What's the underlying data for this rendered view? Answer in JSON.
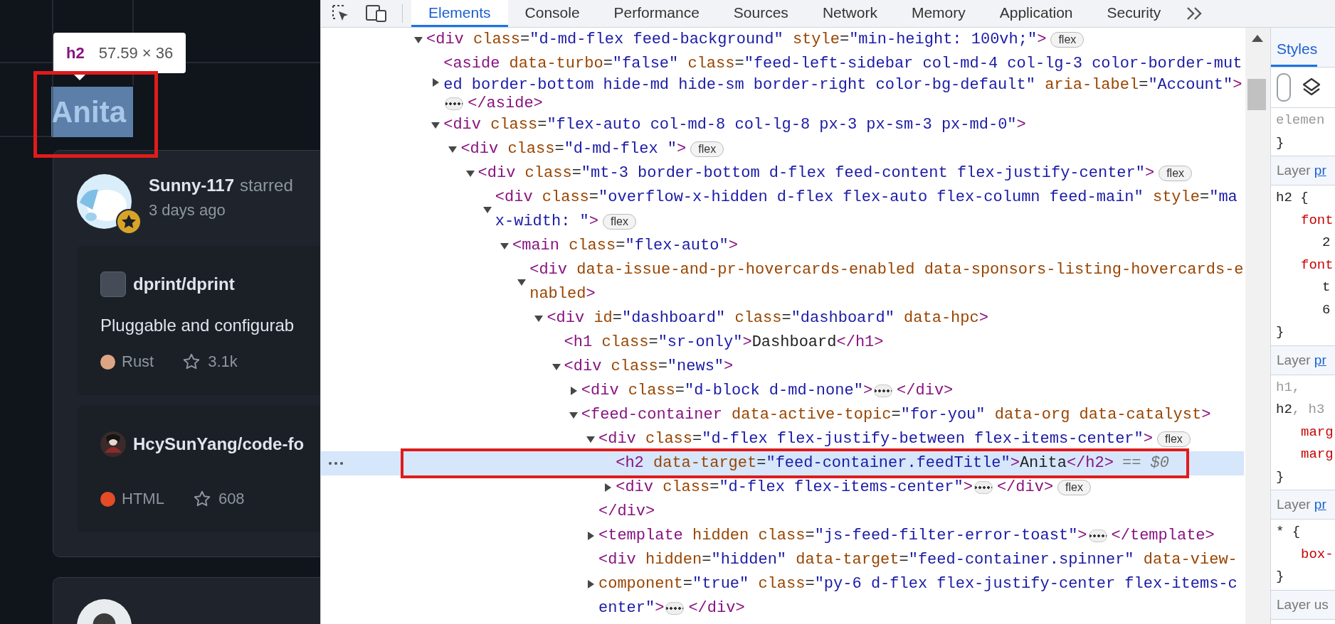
{
  "page": {
    "tooltip": {
      "tag": "h2",
      "size": "57.59 × 36"
    },
    "heading": "Anita",
    "feed": [
      {
        "kind": "star_event",
        "actor": "Sunny-117",
        "action": "starred",
        "time": "3 days ago",
        "repos": [
          {
            "kind": "icon",
            "name": "dprint/dprint",
            "description": "Pluggable and configurab",
            "language": "Rust",
            "color": "#dea584",
            "star_count": "3.1k"
          },
          {
            "kind": "avatar",
            "name": "HcySunYang/code-fo",
            "language": "HTML",
            "color": "#e34c26",
            "star_count": "608"
          }
        ]
      },
      {
        "kind": "partial"
      }
    ]
  },
  "devtools": {
    "tabs": [
      {
        "label": "Elements",
        "selected": true
      },
      {
        "label": "Console",
        "selected": false
      },
      {
        "label": "Performance",
        "selected": false
      },
      {
        "label": "Sources",
        "selected": false
      },
      {
        "label": "Network",
        "selected": false
      },
      {
        "label": "Memory",
        "selected": false
      },
      {
        "label": "Application",
        "selected": false
      },
      {
        "label": "Security",
        "selected": false
      }
    ],
    "tree": {
      "nodes": [
        {
          "markup": "<div class=\"d-md-flex feed-background\" style=\"min-height: 100vh;\">",
          "expanded": true,
          "selected": false,
          "badge": "flex",
          "children": [
            {
              "markup": "<aside data-turbo=\"false\" class=\"feed-left-sidebar col-md-4 col-lg-3 color-border-muted border-bottom hide-md hide-sm border-right color-bg-default\" aria-label=\"Account\">",
              "expanded": false,
              "selected": false,
              "ellipsis": true,
              "end": "</aside>"
            },
            {
              "markup": "<div class=\"flex-auto col-md-8 col-lg-8 px-3 px-sm-3 px-md-0\">",
              "expanded": true,
              "selected": false,
              "children": [
                {
                  "markup": "<div class=\"d-md-flex \">",
                  "expanded": true,
                  "selected": false,
                  "badge": "flex",
                  "children": [
                    {
                      "markup": "<div class=\"mt-3 border-bottom d-flex feed-content flex-justify-center\">",
                      "expanded": true,
                      "selected": false,
                      "badge": "flex",
                      "children": [
                        {
                          "markup": "<div class=\"overflow-x-hidden d-flex flex-auto flex-column feed-main\" style=\"max-width: \">",
                          "expanded": true,
                          "selected": false,
                          "badge": "flex",
                          "children": [
                            {
                              "markup": "<main class=\"flex-auto\">",
                              "expanded": true,
                              "selected": false,
                              "children": [
                                {
                                  "markup": "<div data-issue-and-pr-hovercards-enabled data-sponsors-listing-hovercards-enabled>",
                                  "expanded": true,
                                  "selected": false,
                                  "children": [
                                    {
                                      "markup": "<div id=\"dashboard\" class=\"dashboard\" data-hpc>",
                                      "expanded": true,
                                      "selected": false,
                                      "children": [
                                        {
                                          "markup": "<h1 class=\"sr-only\">Dashboard</h1>",
                                          "selected": false
                                        },
                                        {
                                          "markup": "<div class=\"news\">",
                                          "expanded": true,
                                          "selected": false,
                                          "children": [
                                            {
                                              "markup": "<div class=\"d-block d-md-none\">",
                                              "expanded": false,
                                              "selected": false,
                                              "ellipsis": true,
                                              "end": "</div>"
                                            },
                                            {
                                              "markup": "<feed-container data-active-topic=\"for-you\" data-org data-catalyst>",
                                              "expanded": true,
                                              "selected": false,
                                              "children": [
                                                {
                                                  "markup": "<div class=\"d-flex flex-justify-between flex-items-center\">",
                                                  "expanded": true,
                                                  "selected": false,
                                                  "badge": "flex",
                                                  "closing": "</div>",
                                                  "children": [
                                                    {
                                                      "markup": "<h2 data-target=\"feed-container.feedTitle\">Anita</h2>",
                                                      "selected": true,
                                                      "annotation": "== $0"
                                                    },
                                                    {
                                                      "markup": "<div class=\"d-flex flex-items-center\">",
                                                      "expanded": false,
                                                      "selected": false,
                                                      "ellipsis": true,
                                                      "end": "</div>",
                                                      "badge": "flex"
                                                    }
                                                  ]
                                                },
                                                {
                                                  "markup": "<template hidden class=\"js-feed-filter-error-toast\">",
                                                  "expanded": false,
                                                  "selected": false,
                                                  "ellipsis": true,
                                                  "end": "</template>"
                                                },
                                                {
                                                  "markup": "<div hidden=\"hidden\" data-target=\"feed-container.spinner\" data-view-component=\"true\" class=\"py-6 d-flex flex-justify-center flex-items-center\">",
                                                  "expanded": false,
                                                  "selected": false,
                                                  "ellipsis": true,
                                                  "end": "</div>"
                                                }
                                              ]
                                            }
                                          ]
                                        }
                                      ]
                                    }
                                  ]
                                }
                              ]
                            }
                          ]
                        }
                      ]
                    }
                  ]
                }
              ]
            }
          ]
        }
      ]
    },
    "styles": {
      "tab": {
        "label": "Styles",
        "selected": true
      },
      "sections": [
        {
          "lines": [
            {
              "kind": "selector",
              "parts": [
                {
                  "text": "elemen",
                  "matched": false
                }
              ]
            },
            {
              "kind": "brace",
              "text": "}"
            }
          ]
        },
        {
          "layer": "Layer ",
          "link": "pr",
          "lines": [
            {
              "kind": "selector",
              "parts": [
                {
                  "text": "h2 {",
                  "matched": true
                }
              ]
            },
            {
              "kind": "property",
              "text": "font"
            },
            {
              "kind": "value",
              "text": "2"
            },
            {
              "kind": "property",
              "text": "font"
            },
            {
              "kind": "value",
              "text": "t"
            },
            {
              "kind": "value",
              "text": "6"
            },
            {
              "kind": "brace",
              "text": "}"
            }
          ]
        },
        {
          "layer": "Layer ",
          "link": "pr",
          "lines": [
            {
              "kind": "selector",
              "parts": [
                {
                  "text": "h1,",
                  "matched": false
                }
              ]
            },
            {
              "kind": "selector",
              "parts": [
                {
                  "text": "h2",
                  "matched": true
                },
                {
                  "text": ", h3",
                  "matched": false
                }
              ]
            },
            {
              "kind": "property",
              "text": "marg"
            },
            {
              "kind": "property",
              "text": "marg"
            },
            {
              "kind": "brace",
              "text": "}"
            }
          ]
        },
        {
          "layer": "Layer ",
          "link": "pr",
          "lines": [
            {
              "kind": "selector",
              "parts": [
                {
                  "text": "* {",
                  "matched": true
                }
              ]
            },
            {
              "kind": "property",
              "text": "box-"
            },
            {
              "kind": "brace",
              "text": "}"
            }
          ]
        },
        {
          "layer": "Layer us"
        }
      ]
    }
  }
}
